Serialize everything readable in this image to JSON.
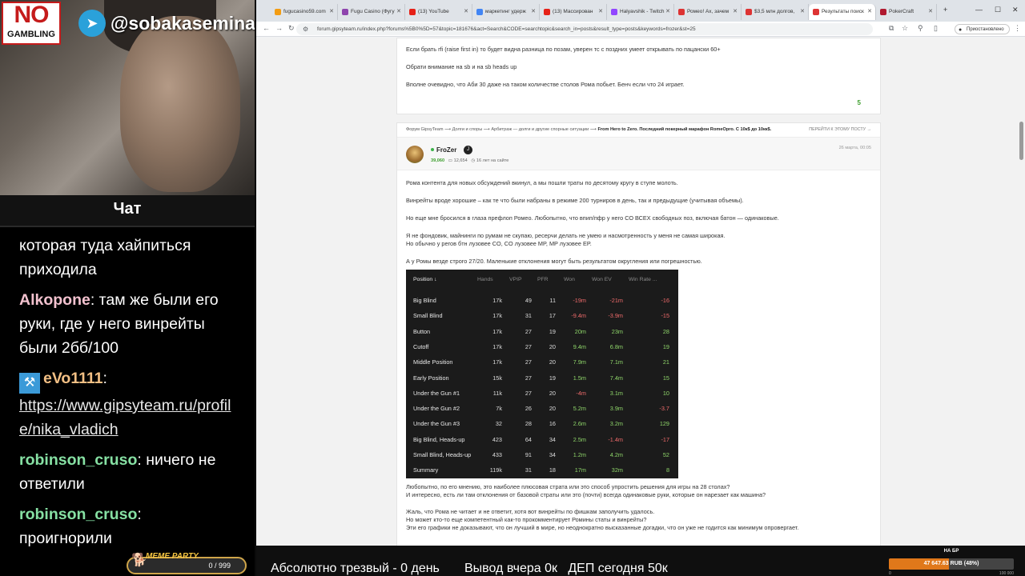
{
  "stream": {
    "no_logo_top": "NO",
    "no_logo_bottom": "GAMBLING",
    "telegram_handle": "@sobakasemina",
    "chat_title": "Чат",
    "chat": [
      {
        "user": "",
        "text": "которая туда хайпиться приходила"
      },
      {
        "user": "Alkopone",
        "sep": ":",
        "text": " там же были его руки, где у него винрейты были 2бб/100"
      },
      {
        "user": "eVo1111",
        "sep": ":",
        "text": "https://www.gipsyteam.ru/profile/nika_vladich"
      },
      {
        "user": "robinson_cruso",
        "sep": ":",
        "text": " ничего не ответили"
      },
      {
        "user": "robinson_cruso",
        "sep": ":",
        "text": " проигнорили"
      }
    ],
    "meme_party": {
      "title": "MEME PARTY",
      "value": "0 / 999"
    },
    "ticker": "Абсолютно трезвый - 0 день       Вывод вчера 0к   ДЕП сегодня 50к",
    "goal": {
      "title": "НА БР",
      "text": "47 647.63 RUB (48%)",
      "percent": 48,
      "min": "0",
      "max": "100 000"
    }
  },
  "browser": {
    "tabs": [
      {
        "title": "fugucasino59.com",
        "color": "#f39c12"
      },
      {
        "title": "Fugu Casino (Фугу",
        "color": "#8e44ad"
      },
      {
        "title": "(13) YouTube",
        "color": "#e62117"
      },
      {
        "title": "маркетинг удерж",
        "color": "#4285f4"
      },
      {
        "title": "(13) Массирован",
        "color": "#e62117"
      },
      {
        "title": "Halyavshik - Twitch",
        "color": "#9146ff"
      },
      {
        "title": "Ромео! Ах, зачем",
        "color": "#d33"
      },
      {
        "title": "$3,5 млн долгов, ",
        "color": "#d33"
      },
      {
        "title": "Результаты поиск",
        "color": "#d33",
        "active": true
      },
      {
        "title": "PokerCraft",
        "color": "#b0192f"
      }
    ],
    "url": "forum.gipsyteam.ru/index.php?forums%5B0%5D=57&topic=181676&act=Search&CODE=searchtopic&search_in=posts&result_type=posts&keywords=frozer&st=25",
    "incognito_label": "Приостановлено"
  },
  "post1": {
    "lines": [
      "Если брать rfi (raise first in) то будет видна разница по позам, уверен тс с поздних умеет открывать по пацански 60+",
      "Обрати внимание на sb и на sb heads up",
      "Вполне очевидно, что Аби 30 даже на таком количестве столов Рома побьет. Бенч если что 24 играет."
    ],
    "score": "5"
  },
  "post2": {
    "breadcrumb": [
      "Форум GipsyTeam",
      "Долги и споры",
      "Арбитраж — долги и другие спорные ситуации"
    ],
    "topic": "From Hero to Zero. Последний покерный марафон RomeOpro. С 10к$ до 10кк$.",
    "jump": "ПЕРЕЙТИ К ЭТОМУ ПОСТУ →",
    "author": "FroZer",
    "badge": "J",
    "rating": "39,060",
    "posts": "12,654",
    "age": "16 лет на сайте",
    "date": "26 марта, 00:05",
    "paragraphs": [
      "Рома контента для новых обсуждений вкинул, а мы пошли траты по десятому кругу в ступе молоть.",
      "Винрейты вроде хорошие – как те что были набраны в режиме 200 турниров в день, так и предыдущие (учитывая объемы).",
      "Но еще мне бросился в глаза префлоп Ромео. Любопытно, что впип/пфр у него СО ВСЕХ свободных поз, включая батон — одинаковые.",
      "Я не фондовик, майнинги по румам не скупаю, ресерчи делать не умею и насмотренность у меня не самая широкая.\nНо обычно у регов бтн лузовее CO, CO лузовее MP, MP лузовее EP.",
      "А у Ромы везде строго 27/20. Маленькие отклонения могут быть результатом округления или погрешностью."
    ],
    "after": [
      "Любопытно, по его мнению, это наиболее плюсовая страта или это способ упростить решения для игры на 28 столах?\nИ интересно, есть ли там отклонения от базовой страты или это (почти) всегда одинаковые руки, которые он нарезает как машина?",
      "Жаль, что Рома не читает и не ответит, хотя вот винрейты по фишкам заполучить удалось.\nНо может кто-то еще компетентный как-то прокомментирует Ромины статы и винрейты?\nЭти его графики не доказывают, что он лучший в мире, но неоднократно высказанные догадки, что он уже не годится как минимум опровергает."
    ]
  },
  "stats_table": {
    "headers": [
      "Position ↓",
      "Hands",
      "VPIP",
      "PFR",
      "Won",
      "Won EV",
      "Win Rate ..."
    ],
    "rows": [
      [
        "Big Blind",
        "17k",
        "49",
        "11",
        "-19m",
        "-21m",
        "-16"
      ],
      [
        "Small Blind",
        "17k",
        "31",
        "17",
        "-9.4m",
        "-3.9m",
        "-15"
      ],
      [
        "Button",
        "17k",
        "27",
        "19",
        "20m",
        "23m",
        "28"
      ],
      [
        "Cutoff",
        "17k",
        "27",
        "20",
        "9.4m",
        "6.8m",
        "19"
      ],
      [
        "Middle Position",
        "17k",
        "27",
        "20",
        "7.9m",
        "7.1m",
        "21"
      ],
      [
        "Early Position",
        "15k",
        "27",
        "19",
        "1.5m",
        "7.4m",
        "15"
      ],
      [
        "Under the Gun #1",
        "11k",
        "27",
        "20",
        "-4m",
        "3.1m",
        "10"
      ],
      [
        "Under the Gun #2",
        "7k",
        "26",
        "20",
        "5.2m",
        "3.9m",
        "-3.7"
      ],
      [
        "Under the Gun #3",
        "32",
        "28",
        "16",
        "2.6m",
        "3.2m",
        "129"
      ],
      [
        "Big Blind, Heads-up",
        "423",
        "64",
        "34",
        "2.5m",
        "-1.4m",
        "-17"
      ],
      [
        "Small Blind, Heads-up",
        "433",
        "91",
        "34",
        "1.2m",
        "4.2m",
        "52"
      ],
      [
        "Summary",
        "119k",
        "31",
        "18",
        "17m",
        "32m",
        "8"
      ]
    ]
  }
}
